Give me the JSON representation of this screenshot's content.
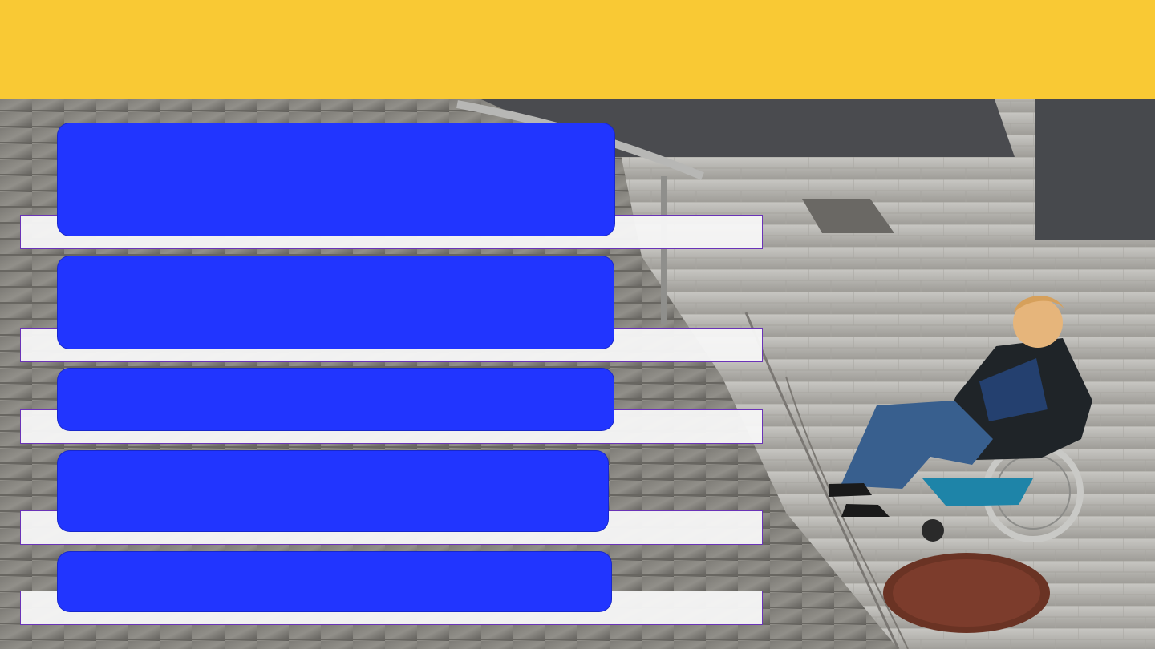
{
  "slide": {
    "banner_color": "#f9c934",
    "card_color": "#2135ff",
    "strip_color": "#f6f6f6",
    "strip_border_color": "#6a33b7",
    "background_image": "wheelchair-user-near-stairs-photo"
  },
  "cards": [
    {
      "label": ""
    },
    {
      "label": ""
    },
    {
      "label": ""
    },
    {
      "label": ""
    },
    {
      "label": ""
    }
  ]
}
